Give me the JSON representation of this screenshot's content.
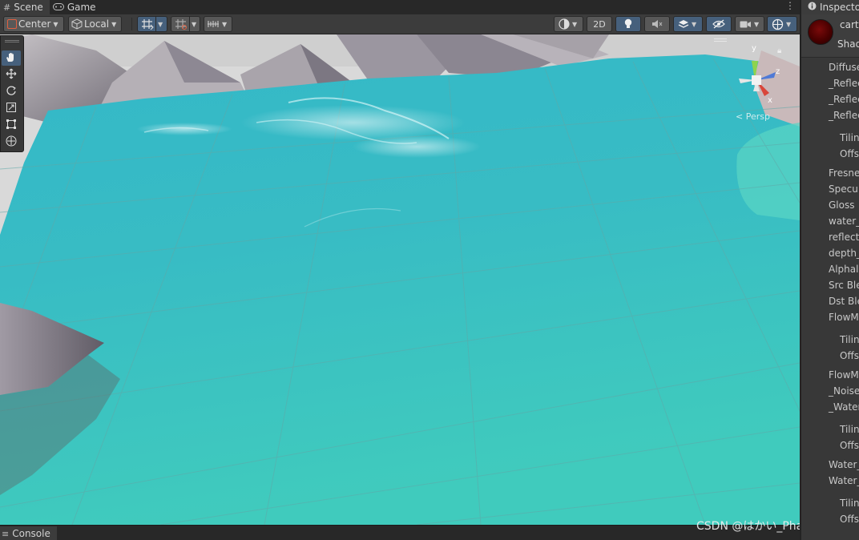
{
  "tabs": [
    {
      "label": "Scene",
      "icon": "hash-icon",
      "active": true
    },
    {
      "label": "Game",
      "icon": "gamepad-icon",
      "active": false
    }
  ],
  "toolbar": {
    "pivot_label": "Center",
    "space_label": "Local",
    "mode_2d_label": "2D"
  },
  "gizmo": {
    "y_label": "y",
    "z_label": "z",
    "x_label": "x",
    "persp_label": "Persp"
  },
  "console_label": "Console",
  "watermark": "CSDN @はかい_Phantom",
  "inspector": {
    "tab_label": "Inspector",
    "material_name": "carto",
    "shader_label": "Shad",
    "properties": [
      "Diffuse",
      "_Reflec",
      "_Reflec",
      "_Reflec",
      "Tilin",
      "Offs",
      "Fresne",
      "Specul",
      "Gloss",
      "water_",
      "reflecti",
      "depth_",
      "Alphal",
      "Src Ble",
      "Dst Ble",
      "FlowM",
      "Tilin",
      "Offs",
      "FlowM",
      "_Noise_",
      "_Water",
      "Tilin",
      "Offs",
      "Water_",
      "Water_",
      "Tilin",
      "Offs"
    ]
  },
  "colors": {
    "water_near": "#3fcabe",
    "water_far": "#34b8c8",
    "active_blue": "#46607c",
    "material_red": "#7a0a0a"
  }
}
